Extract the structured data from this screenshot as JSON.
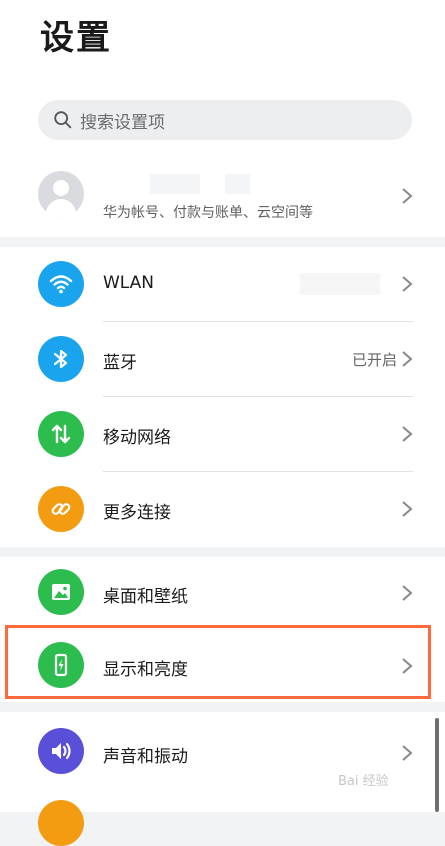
{
  "header": {
    "title": "设置"
  },
  "search": {
    "placeholder": "搜索设置项",
    "icon": "search-icon"
  },
  "account": {
    "subtitle": "华为帐号、付款与账单、云空间等",
    "icon": "avatar-icon"
  },
  "groups": {
    "connectivity": [
      {
        "label": "WLAN",
        "value": "",
        "icon": "wifi-icon",
        "color": "#1aa4ee"
      },
      {
        "label": "蓝牙",
        "value": "已开启",
        "icon": "bluetooth-icon",
        "color": "#1aa4ee"
      },
      {
        "label": "移动网络",
        "value": "",
        "icon": "mobile-data-icon",
        "color": "#2dbd4e"
      },
      {
        "label": "更多连接",
        "value": "",
        "icon": "link-icon",
        "color": "#f39c12"
      }
    ],
    "display": [
      {
        "label": "桌面和壁纸",
        "value": "",
        "icon": "image-icon",
        "color": "#2dbd4e"
      },
      {
        "label": "显示和亮度",
        "value": "",
        "icon": "display-icon",
        "color": "#2dbd4e"
      }
    ],
    "sound": [
      {
        "label": "声音和振动",
        "value": "",
        "icon": "speaker-icon",
        "color": "#5a4fd8"
      }
    ]
  },
  "colors": {
    "highlight": "#ff6a3d",
    "background": "#f1f3f5"
  },
  "watermark": {
    "text": "Bai 经验"
  }
}
